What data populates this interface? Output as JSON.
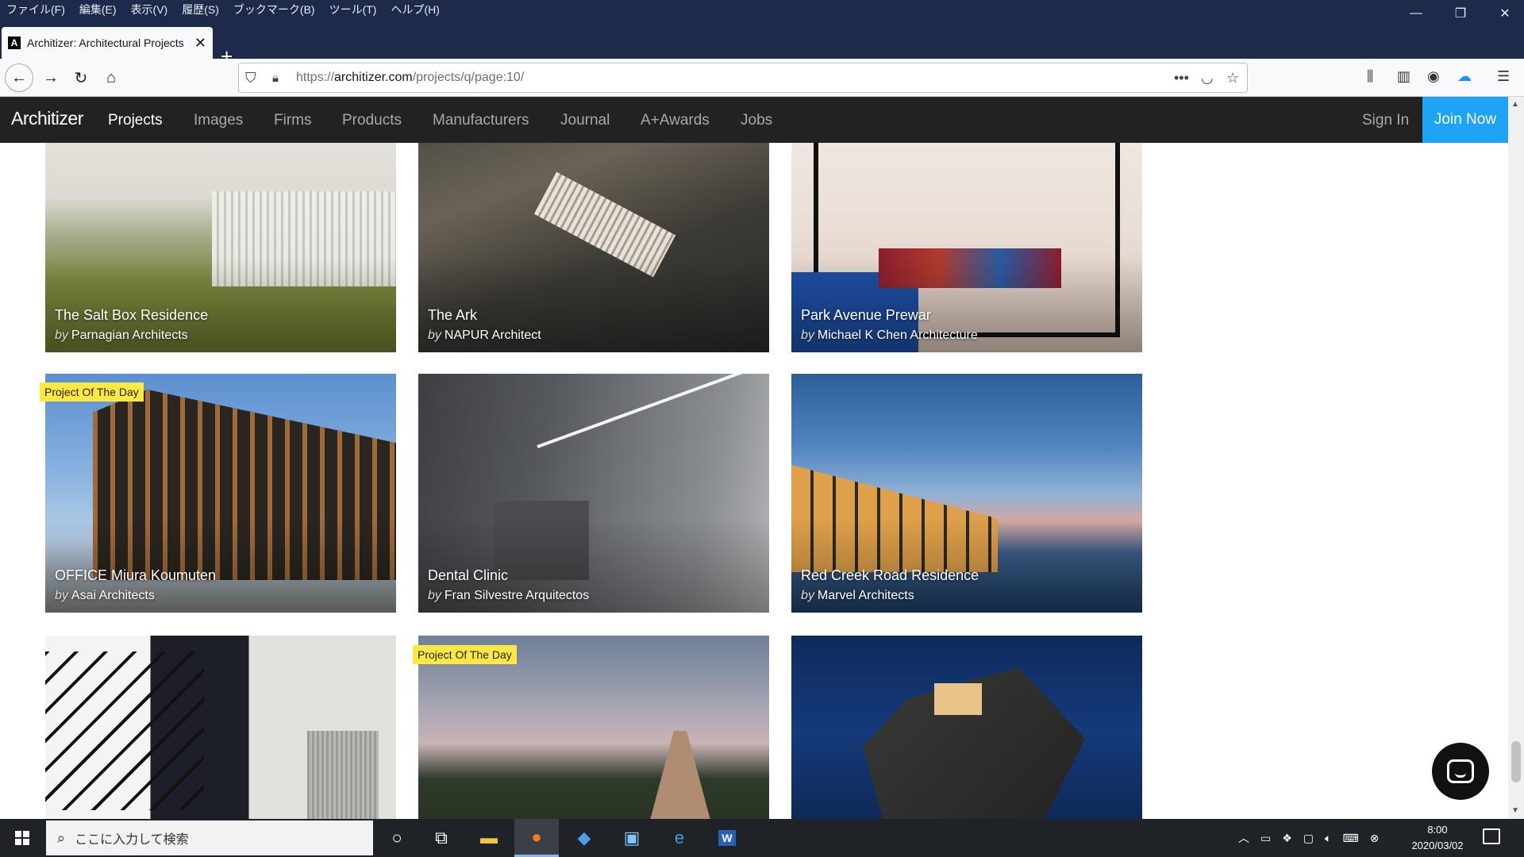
{
  "browser": {
    "menu": [
      "ファイル(F)",
      "編集(E)",
      "表示(V)",
      "履歴(S)",
      "ブックマーク(B)",
      "ツール(T)",
      "ヘルプ(H)"
    ],
    "tab_title": "Architizer: Architectural Projects",
    "tab_favicon": "A",
    "url_scheme": "https://",
    "url_host": "architizer.com",
    "url_path": "/projects/q/page:10/",
    "window_controls": {
      "minimize": "—",
      "restore": "❐",
      "close": "✕"
    }
  },
  "site": {
    "logo": "Architizer",
    "nav": [
      "Projects",
      "Images",
      "Firms",
      "Products",
      "Manufacturers",
      "Journal",
      "A+Awards",
      "Jobs"
    ],
    "active_nav": "Projects",
    "sign_in": "Sign In",
    "join_now": "Join Now",
    "accent_color": "#1ea3f5"
  },
  "projects": [
    {
      "title": "The Salt Box Residence",
      "by": "by",
      "firm": "Parnagian Architects",
      "badge": ""
    },
    {
      "title": "The Ark",
      "by": "by",
      "firm": "NAPUR Architect",
      "badge": ""
    },
    {
      "title": "Park Avenue Prewar",
      "by": "by",
      "firm": "Michael K Chen Architecture",
      "badge": ""
    },
    {
      "title": "OFFICE Miura Koumuten",
      "by": "by",
      "firm": "Asai Architects",
      "badge": "Project Of The Day"
    },
    {
      "title": "Dental Clinic",
      "by": "by",
      "firm": "Fran Silvestre Arquitectos",
      "badge": ""
    },
    {
      "title": "Red Creek Road Residence",
      "by": "by",
      "firm": "Marvel Architects",
      "badge": ""
    },
    {
      "title": "",
      "by": "",
      "firm": "",
      "badge": ""
    },
    {
      "title": "",
      "by": "",
      "firm": "",
      "badge": "Project Of The Day"
    },
    {
      "title": "",
      "by": "",
      "firm": "",
      "badge": ""
    }
  ],
  "taskbar": {
    "search_placeholder": "ここに入力して検索",
    "time": "8:00",
    "date": "2020/03/02"
  }
}
